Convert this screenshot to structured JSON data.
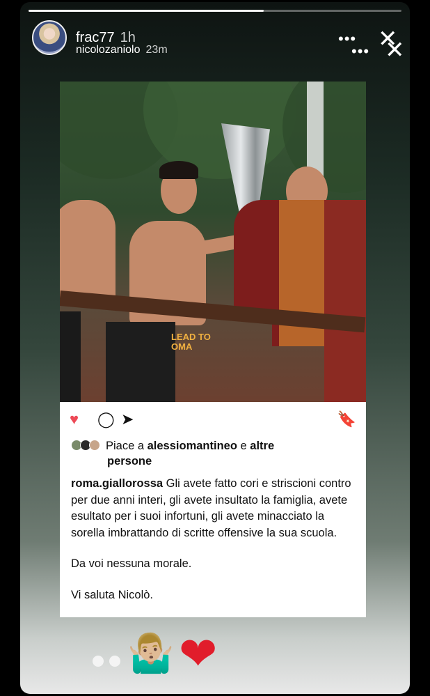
{
  "story": {
    "progress_percent": 63,
    "username_primary": "frac77",
    "time_primary": "1h",
    "username_secondary": "nicolozaniolo",
    "time_secondary": "23m",
    "more_glyph": "•••",
    "close_glyph": "✕"
  },
  "post": {
    "like_glyph": "♥",
    "comment_glyph": "◯",
    "share_glyph": "➤",
    "save_glyph": "🔖",
    "likes_prefix": "Piace a ",
    "likes_user": "alessiomantineo",
    "likes_middle": " e ",
    "likes_others_1": "altre",
    "likes_others_2": "persone",
    "caption_user": "roma.giallorossa",
    "caption_text": " Gli avete fatto cori e striscioni contro per due anni interi, gli avete insultato la famiglia, avete esultato per i suoi infortuni, gli avete minacciato la sorella imbrattando di scritte offensive la sua scuola.",
    "caption_line2": "Da voi nessuna morale.",
    "caption_line3": "Vi saluta Nicolò.",
    "photo_shirt_text": "LEAD TO\nOMA"
  },
  "reactions": {
    "shrug_emoji": "🤷🏼‍♂️",
    "heart_emoji": "❤"
  },
  "colors": {
    "like_red": "#ed4956",
    "heart_red": "#e11d2b",
    "roma_maroon": "#7d1d1c",
    "roma_orange": "#b7652a"
  }
}
